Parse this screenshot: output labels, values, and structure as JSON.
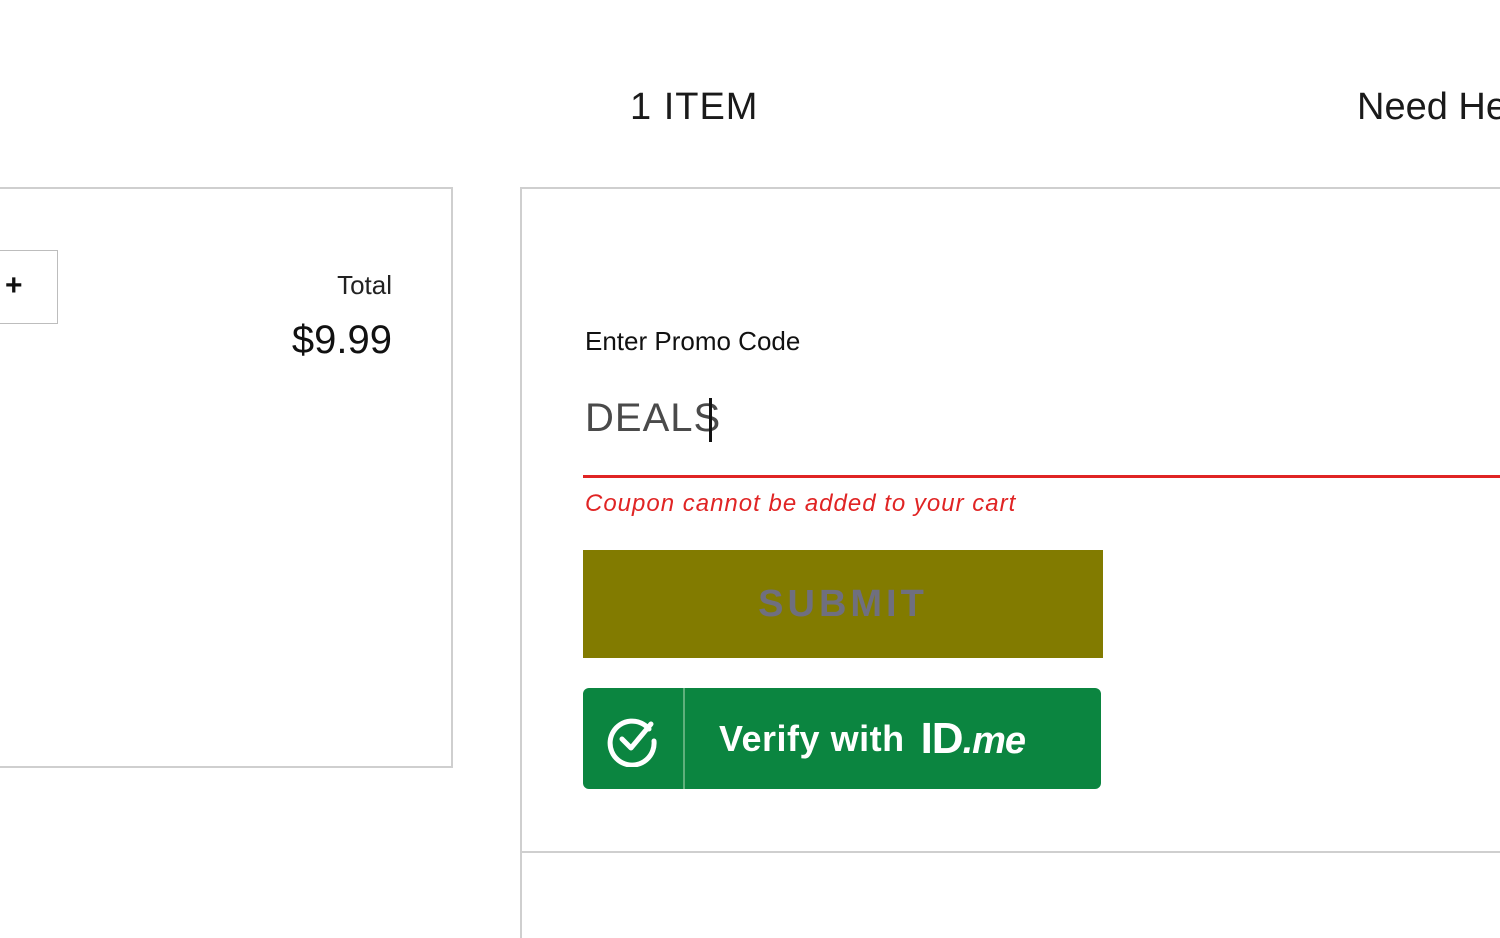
{
  "header": {
    "item_count": "1 ITEM",
    "help_text": "Need He"
  },
  "cart": {
    "plus_symbol": "+",
    "total_label": "Total",
    "total_value": "$9.99"
  },
  "promo": {
    "label": "Enter Promo Code",
    "input_value": "DEALS",
    "error_message": "Coupon cannot be added to your cart",
    "error_color": "#e02424",
    "submit_label": "SUBMIT",
    "submit_color": "#827b00",
    "idme": {
      "verify_text": "Verify with",
      "brand_main": "ID",
      "brand_suffix": ".me",
      "color": "#0b8540",
      "icon": "check-circle-icon"
    }
  }
}
